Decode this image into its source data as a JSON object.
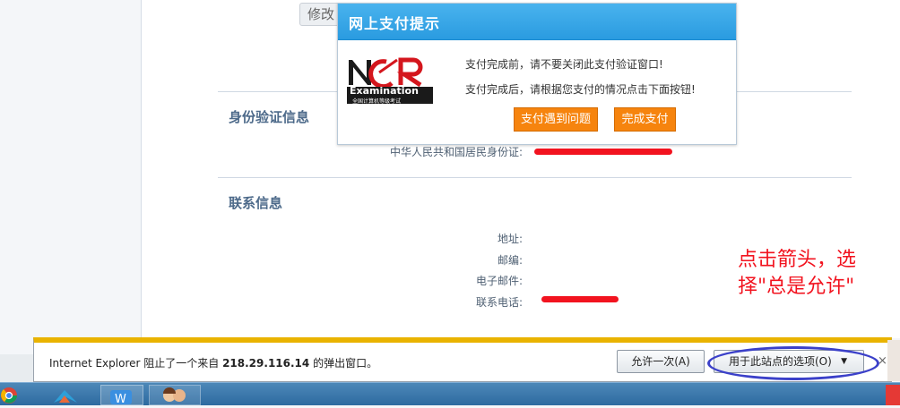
{
  "page": {
    "modify_label": "修改",
    "identity_section": "身份验证信息",
    "id_label": "中华人民共和国居民身份证:",
    "contact_section": "联系信息",
    "address_label": "地址:",
    "postcode_label": "邮编:",
    "email_label": "电子邮件:",
    "phone_label": "联系电话:"
  },
  "modal": {
    "title": "网上支付提示",
    "logo_text": "Examination",
    "logo_subtext": "全国计算机等级考试",
    "message_1": "支付完成前，请不要关闭此支付验证窗口!",
    "message_2": "支付完成后，请根据您支付的情况点击下面按钮!",
    "problem_button": "支付遇到问题",
    "done_button": "完成支付"
  },
  "annotation": {
    "text": "点击箭头，选择\"总是允许\""
  },
  "ie_bar": {
    "message_prefix": "Internet Explorer 阻止了一个来自",
    "blocked_host": "218.29.116.14",
    "message_suffix": "的弹出窗口。",
    "allow_once_button": "允许一次(A)",
    "site_options_button": "用于此站点的选项(O)",
    "close_label": "×"
  },
  "colors": {
    "accent_orange": "#f6840e",
    "header_blue": "#2a9be0",
    "annotation_red": "#f2131f",
    "annotation_blue": "#3b40c9"
  }
}
